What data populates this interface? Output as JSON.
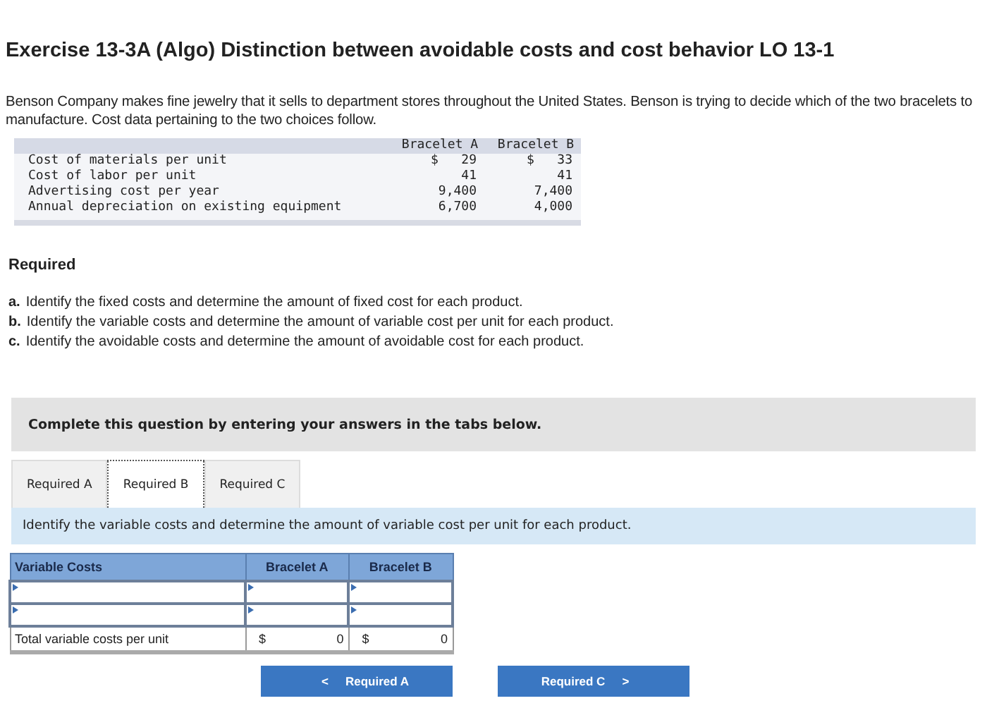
{
  "title": "Exercise 13-3A (Algo) Distinction between avoidable costs and cost behavior LO 13-1",
  "intro": "Benson Company makes fine jewelry that it sells to department stores throughout the United States. Benson is trying to decide which of the two bracelets to manufacture. Cost data pertaining to the two choices follow.",
  "cost_table": {
    "columns": [
      "Bracelet A",
      "Bracelet B"
    ],
    "rows": [
      {
        "label": "Cost of materials per unit",
        "values": [
          "$   29",
          "$   33"
        ]
      },
      {
        "label": "Cost of labor per unit",
        "values": [
          "41",
          "41"
        ]
      },
      {
        "label": "Advertising cost per year",
        "values": [
          "9,400",
          "7,400"
        ]
      },
      {
        "label": "Annual depreciation on existing equipment",
        "values": [
          "6,700",
          "4,000"
        ]
      }
    ]
  },
  "required_heading": "Required",
  "requirements": [
    {
      "letter": "a.",
      "text": "Identify the fixed costs and determine the amount of fixed cost for each product."
    },
    {
      "letter": "b.",
      "text": "Identify the variable costs and determine the amount of variable cost per unit for each product."
    },
    {
      "letter": "c.",
      "text": "Identify the avoidable costs and determine the amount of avoidable cost for each product."
    }
  ],
  "banner": "Complete this question by entering your answers in the tabs below.",
  "tabs": [
    {
      "label": "Required A",
      "selected": false
    },
    {
      "label": "Required B",
      "selected": true
    },
    {
      "label": "Required C",
      "selected": false
    }
  ],
  "instruction": "Identify the variable costs and determine the amount of variable cost per unit for each product.",
  "answer_table": {
    "columns": [
      "Variable Costs",
      "Bracelet A",
      "Bracelet B"
    ],
    "input_rows": [
      {
        "kind": "entry"
      },
      {
        "kind": "entry"
      }
    ],
    "total": {
      "label": "Total variable costs per unit",
      "cells": [
        {
          "currency": "$",
          "value": "0"
        },
        {
          "currency": "$",
          "value": "0"
        }
      ]
    }
  },
  "nav": [
    {
      "kind": "prev",
      "glyph": "<",
      "label": "Required A"
    },
    {
      "kind": "next",
      "glyph": ">",
      "label": "Required C"
    }
  ]
}
